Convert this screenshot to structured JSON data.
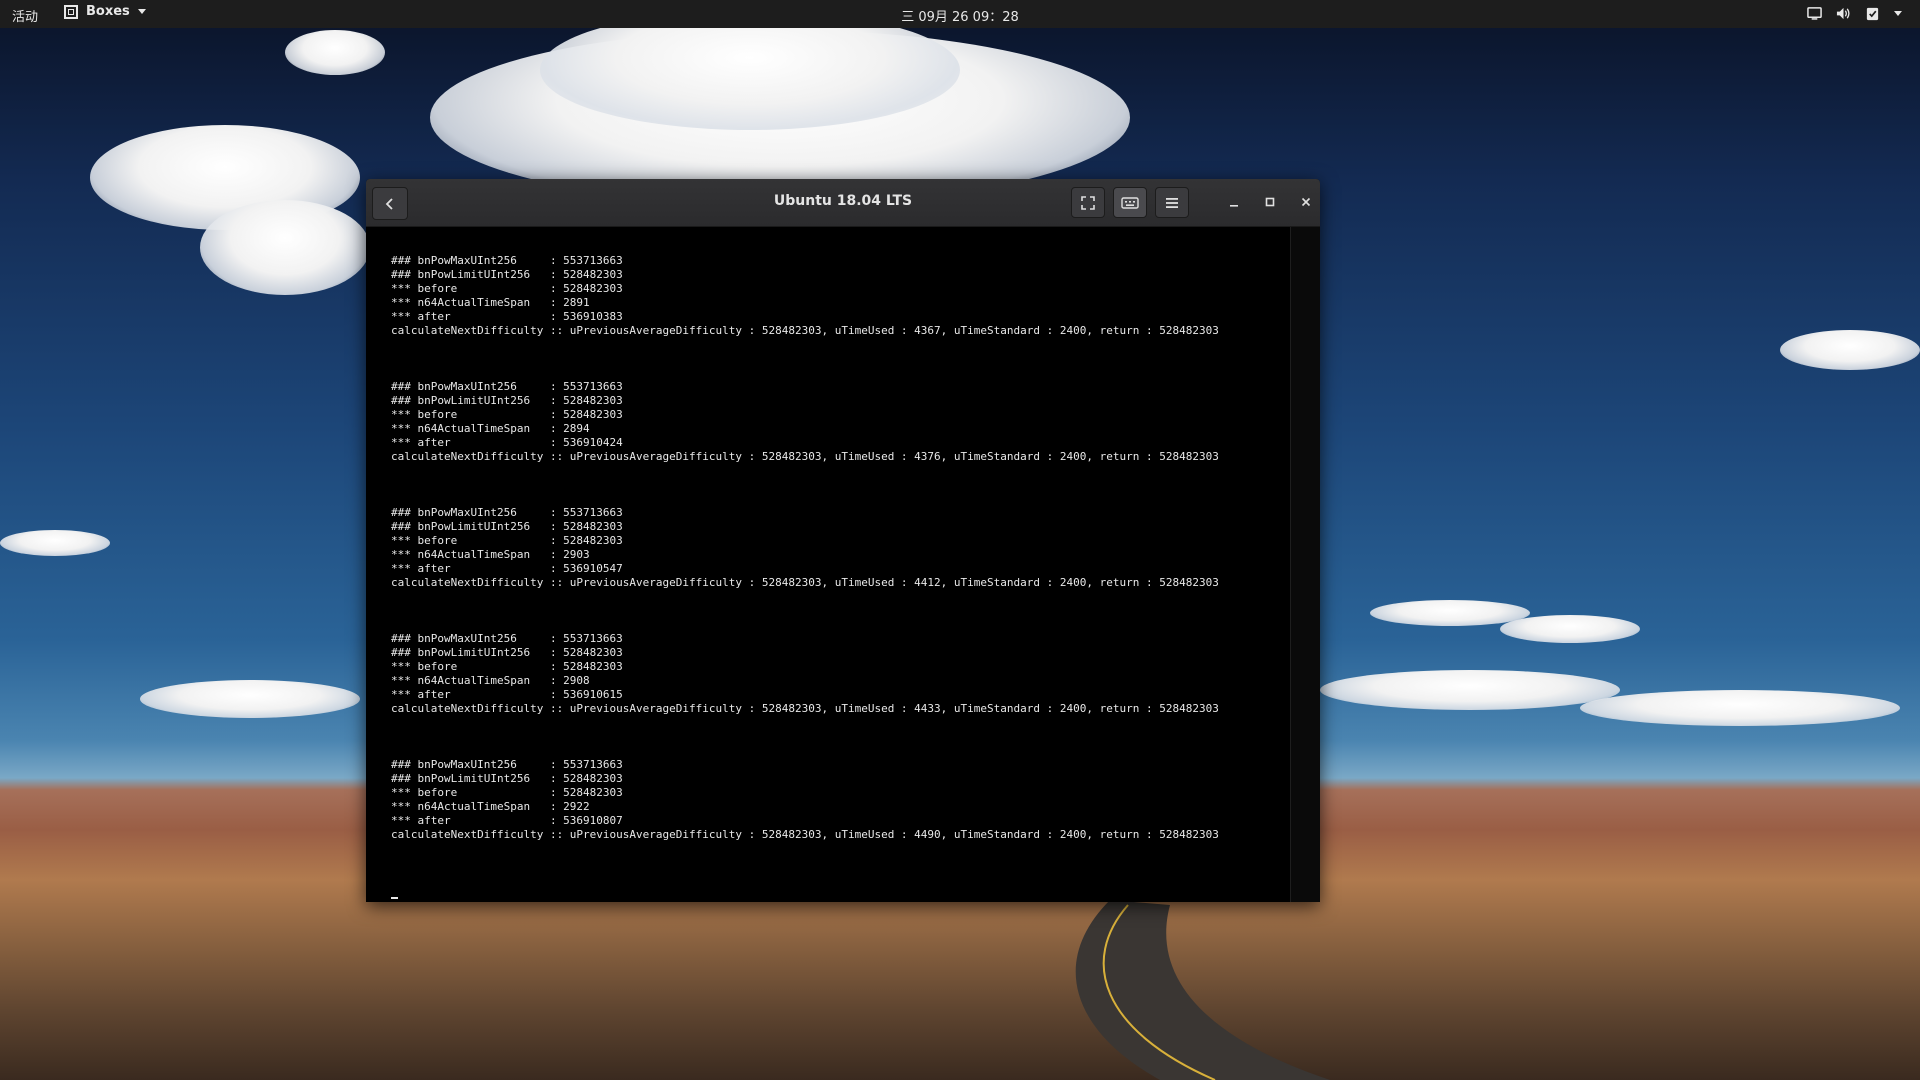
{
  "topbar": {
    "activities": "活动",
    "app_name": "Boxes",
    "clock": "三 09月 26  09：28",
    "status_icons": [
      "display-icon",
      "volume-icon",
      "clipboard-check-icon",
      "chevron-down-icon"
    ]
  },
  "window": {
    "title": "Ubuntu 18.04 LTS",
    "back_icon": "chevron-left-icon",
    "buttons": [
      "fullscreen-icon",
      "keyboard-icon",
      "menu-icon"
    ],
    "controls": [
      "minimize-icon",
      "maximize-icon",
      "close-icon"
    ]
  },
  "terminal": {
    "blocks": [
      {
        "lines": [
          "### bnPowMaxUInt256     : 553713663",
          "### bnPowLimitUInt256   : 528482303",
          "*** before              : 528482303",
          "*** n64ActualTimeSpan   : 2891",
          "*** after               : 536910383",
          "calculateNextDifficulty :: uPreviousAverageDifficulty : 528482303, uTimeUsed : 4367, uTimeStandard : 2400, return : 528482303"
        ]
      },
      {
        "lines": [
          "### bnPowMaxUInt256     : 553713663",
          "### bnPowLimitUInt256   : 528482303",
          "*** before              : 528482303",
          "*** n64ActualTimeSpan   : 2894",
          "*** after               : 536910424",
          "calculateNextDifficulty :: uPreviousAverageDifficulty : 528482303, uTimeUsed : 4376, uTimeStandard : 2400, return : 528482303"
        ]
      },
      {
        "lines": [
          "### bnPowMaxUInt256     : 553713663",
          "### bnPowLimitUInt256   : 528482303",
          "*** before              : 528482303",
          "*** n64ActualTimeSpan   : 2903",
          "*** after               : 536910547",
          "calculateNextDifficulty :: uPreviousAverageDifficulty : 528482303, uTimeUsed : 4412, uTimeStandard : 2400, return : 528482303"
        ]
      },
      {
        "lines": [
          "### bnPowMaxUInt256     : 553713663",
          "### bnPowLimitUInt256   : 528482303",
          "*** before              : 528482303",
          "*** n64ActualTimeSpan   : 2908",
          "*** after               : 536910615",
          "calculateNextDifficulty :: uPreviousAverageDifficulty : 528482303, uTimeUsed : 4433, uTimeStandard : 2400, return : 528482303"
        ]
      },
      {
        "lines": [
          "### bnPowMaxUInt256     : 553713663",
          "### bnPowLimitUInt256   : 528482303",
          "*** before              : 528482303",
          "*** n64ActualTimeSpan   : 2922",
          "*** after               : 536910807",
          "calculateNextDifficulty :: uPreviousAverageDifficulty : 528482303, uTimeUsed : 4490, uTimeStandard : 2400, return : 528482303"
        ]
      }
    ]
  }
}
